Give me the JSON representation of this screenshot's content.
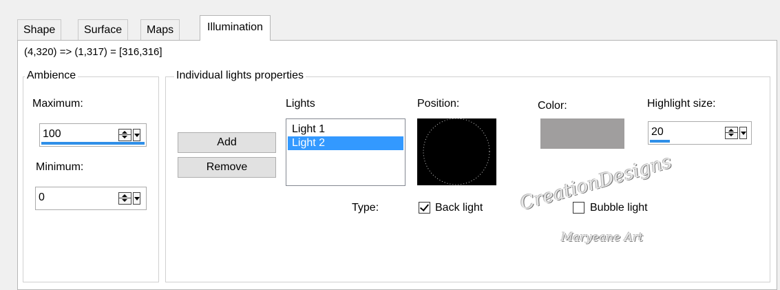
{
  "tabs": [
    {
      "label": "Shape"
    },
    {
      "label": "Surface"
    },
    {
      "label": "Maps"
    },
    {
      "label": "Illumination"
    }
  ],
  "coords_text": "(4,320) => (1,317) = [316,316]",
  "ambience": {
    "legend": "Ambience",
    "maximum_label": "Maximum:",
    "maximum_value": "100",
    "maximum_fill_percent": 100,
    "minimum_label": "Minimum:",
    "minimum_value": "0",
    "minimum_fill_percent": 0
  },
  "lights_group": {
    "legend": "Individual lights properties",
    "add_label": "Add",
    "remove_label": "Remove",
    "lights_label": "Lights",
    "lights": [
      "Light 1",
      "Light 2"
    ],
    "selected_light": "Light 2",
    "position_label": "Position:",
    "color_label": "Color:",
    "color_value": "#a09e9e",
    "highlight_label": "Highlight size:",
    "highlight_value": "20",
    "highlight_fill_percent": 20,
    "type_label": "Type:",
    "back_light_label": "Back light",
    "back_light_checked": true,
    "bubble_light_label": "Bubble light",
    "bubble_light_checked": false
  },
  "watermark": {
    "line1": "CreationDesigns",
    "line2": "Maryeane Art"
  },
  "colors": {
    "accent": "#3399ff",
    "spin_fill": "#2f8fe8",
    "panel_bg": "#ffffff",
    "window_bg": "#f0f0f0"
  }
}
